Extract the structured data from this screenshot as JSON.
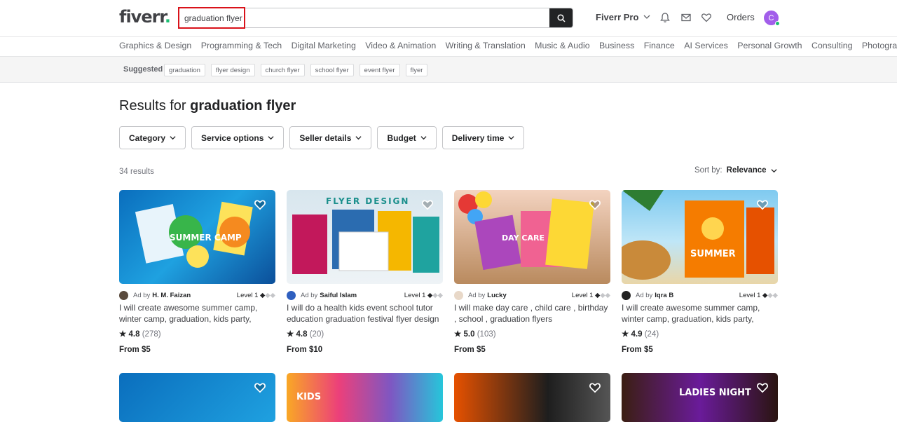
{
  "header": {
    "logo_text": "fiverr",
    "logo_dot": ".",
    "search_value": "graduation flyer",
    "pro_label": "Fiverr Pro",
    "orders_label": "Orders",
    "avatar_letter": "C"
  },
  "categories": [
    "Graphics & Design",
    "Programming & Tech",
    "Digital Marketing",
    "Video & Animation",
    "Writing & Translation",
    "Music & Audio",
    "Business",
    "Finance",
    "AI Services",
    "Personal Growth",
    "Consulting",
    "Photography"
  ],
  "suggested": {
    "label": "Suggested",
    "tags": [
      "graduation",
      "flyer design",
      "church flyer",
      "school flyer",
      "event flyer",
      "flyer"
    ]
  },
  "results": {
    "prefix": "Results for",
    "query": "graduation flyer",
    "count_text": "34 results",
    "sort_label": "Sort by:",
    "sort_value": "Relevance"
  },
  "filters": [
    "Category",
    "Service options",
    "Seller details",
    "Budget",
    "Delivery time"
  ],
  "gigs": [
    {
      "ad": "Ad by",
      "seller": "H. M. Faizan",
      "level": "Level 1",
      "title": "I will create awesome summer camp, winter camp, graduation, kids party, scho...",
      "rating": "4.8",
      "reviews": "(278)",
      "price": "From $5"
    },
    {
      "ad": "Ad by",
      "seller": "Saiful Islam",
      "level": "Level 1",
      "title": "I will do a health kids event school tutor education graduation festival flyer design",
      "rating": "4.8",
      "reviews": "(20)",
      "price": "From $10"
    },
    {
      "ad": "Ad by",
      "seller": "Lucky",
      "level": "Level 1",
      "title": "I will make day care , child care , birthday , school , graduation flyers",
      "rating": "5.0",
      "reviews": "(103)",
      "price": "From $5"
    },
    {
      "ad": "Ad by",
      "seller": "Iqra B",
      "level": "Level 1",
      "title": "I will create awesome summer camp, winter camp, graduation, kids party, scho...",
      "rating": "4.9",
      "reviews": "(24)",
      "price": "From $5"
    }
  ],
  "thumb_text": {
    "t1": "SUMMER CAMP",
    "t2": "FLYER DESIGN",
    "t3": "DAY CARE",
    "t4": "SUMMER",
    "r2_1": "KIDS",
    "r2_4": "LADIES NIGHT"
  },
  "colors": {
    "brand": "#1dbf73",
    "search_btn": "#222325",
    "highlight": "#d9121a",
    "avatar": "#a25eea"
  }
}
